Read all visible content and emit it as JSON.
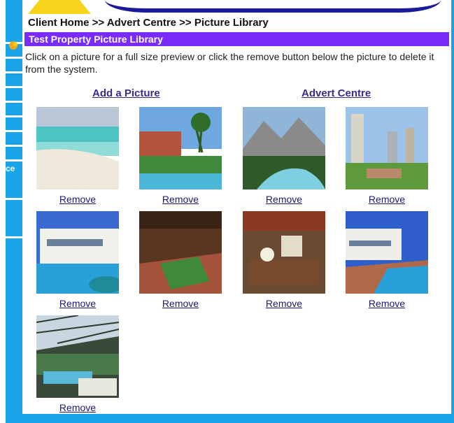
{
  "breadcrumb": "Client Home >> Advert Centre >> Picture Library",
  "title": "Test Property Picture Library",
  "instructions": "Click on a picture for a full size preview or click the remove button below the picture to delete it from the system.",
  "links": {
    "add": "Add a Picture",
    "advert": "Advert Centre"
  },
  "nav": {
    "partial_label": "ce"
  },
  "pictures": [
    {
      "subject": "beach",
      "remove": "Remove"
    },
    {
      "subject": "villa-garden-pool",
      "remove": "Remove"
    },
    {
      "subject": "mountain-river",
      "remove": "Remove"
    },
    {
      "subject": "city-park",
      "remove": "Remove"
    },
    {
      "subject": "villa-pool",
      "remove": "Remove"
    },
    {
      "subject": "billiard-room",
      "remove": "Remove"
    },
    {
      "subject": "living-room",
      "remove": "Remove"
    },
    {
      "subject": "villa-pool-side",
      "remove": "Remove"
    },
    {
      "subject": "conservatory-pool",
      "remove": "Remove"
    }
  ],
  "colors": {
    "frame": "#1aa3e8",
    "title_bar": "#7a2bfb",
    "link": "#3a2a8c"
  }
}
